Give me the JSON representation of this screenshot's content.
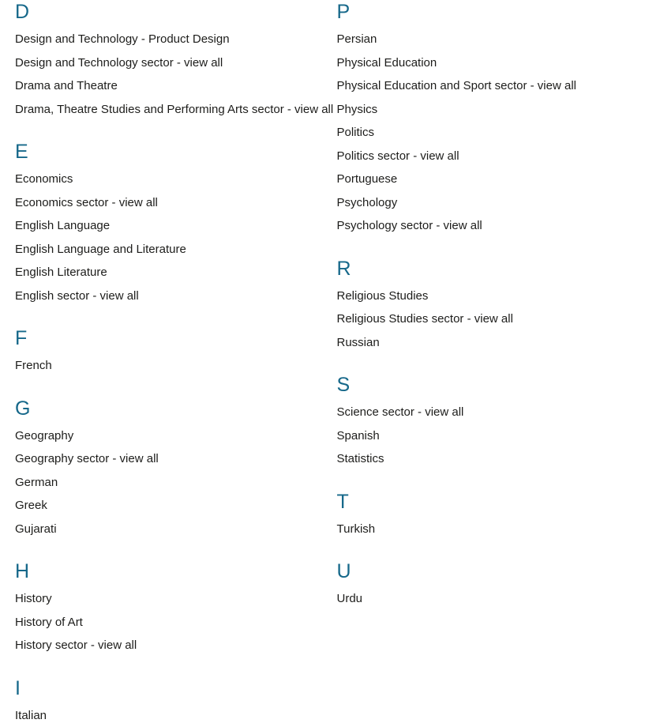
{
  "page": {
    "title": "Subject A-Z listing",
    "background_color": "#ffffff",
    "heading_color": "#16688a",
    "link_color": "#1d1d1b"
  },
  "columns": [
    {
      "name": "left-column",
      "groups": [
        {
          "letter": "D",
          "items": [
            "Design and Technology - Product Design",
            "Design and Technology sector - view all",
            "Drama and Theatre",
            "Drama, Theatre Studies and Performing Arts sector - view all"
          ]
        },
        {
          "letter": "E",
          "items": [
            "Economics",
            "Economics sector - view all",
            "English Language",
            "English Language and Literature",
            "English Literature",
            "English sector - view all"
          ]
        },
        {
          "letter": "F",
          "items": [
            "French"
          ]
        },
        {
          "letter": "G",
          "items": [
            "Geography",
            "Geography sector - view all",
            "German",
            "Greek",
            "Gujarati"
          ]
        },
        {
          "letter": "H",
          "items": [
            "History",
            "History of Art",
            "History sector - view all"
          ]
        },
        {
          "letter": "I",
          "items": [
            "Italian"
          ]
        }
      ]
    },
    {
      "name": "right-column",
      "groups": [
        {
          "letter": "P",
          "items": [
            "Persian",
            "Physical Education",
            "Physical Education and Sport sector - view all",
            "Physics",
            "Politics",
            "Politics sector - view all",
            "Portuguese",
            "Psychology",
            "Psychology sector - view all"
          ]
        },
        {
          "letter": "R",
          "items": [
            "Religious Studies",
            "Religious Studies sector - view all",
            "Russian"
          ]
        },
        {
          "letter": "S",
          "items": [
            "Science sector - view all",
            "Spanish",
            "Statistics"
          ]
        },
        {
          "letter": "T",
          "items": [
            "Turkish"
          ]
        },
        {
          "letter": "U",
          "items": [
            "Urdu"
          ]
        }
      ]
    }
  ]
}
